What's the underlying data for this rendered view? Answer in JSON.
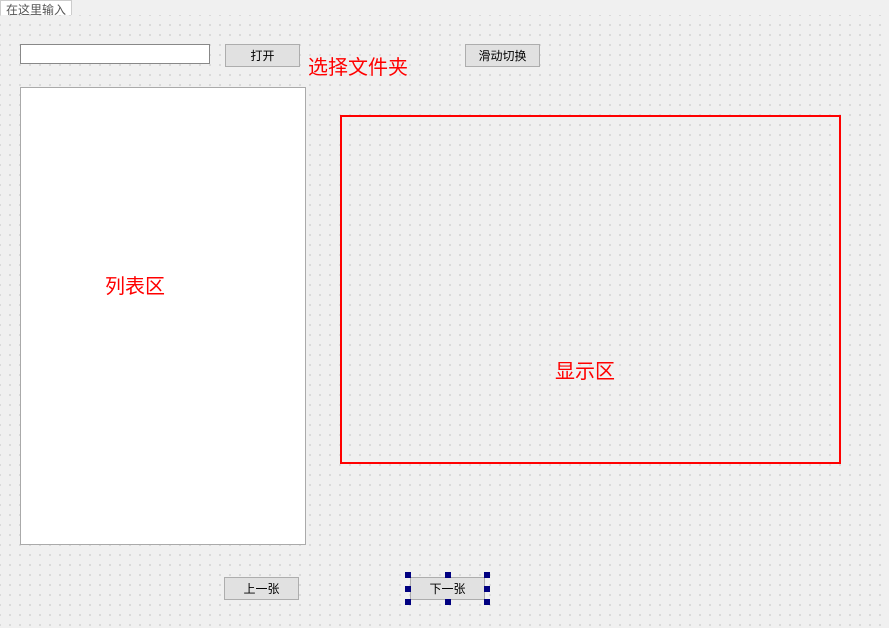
{
  "tab": {
    "label": "在这里输入"
  },
  "buttons": {
    "open": "打开",
    "switch": "滑动切换",
    "prev": "上一张",
    "next": "下一张"
  },
  "labels": {
    "select_folder": "选择文件夹",
    "list_area": "列表区",
    "display_area": "显示区"
  },
  "path_input": {
    "value": ""
  },
  "colors": {
    "annotation": "#ff0000",
    "selection_handle": "#000080"
  }
}
